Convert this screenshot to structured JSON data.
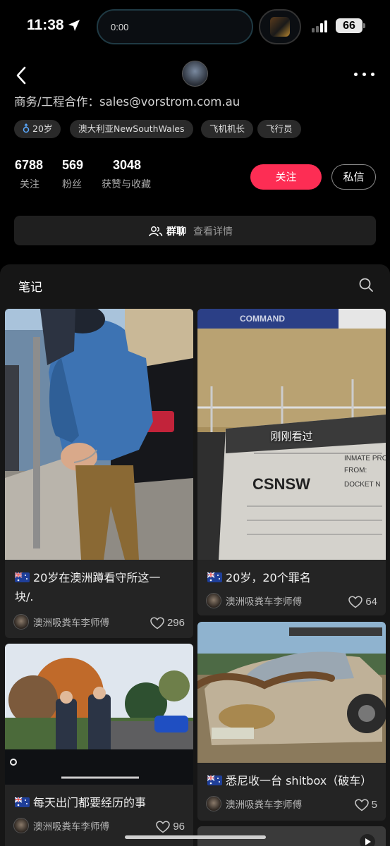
{
  "status_bar": {
    "time": "11:38",
    "island_text": "0:00",
    "battery": "66"
  },
  "profile": {
    "bio": "商务/工程合作：sales@vorstrom.com.au",
    "tags": [
      "20岁",
      "澳大利亚NewSouthWales",
      "飞机机长",
      "飞行员"
    ],
    "stats": [
      {
        "value": "6788",
        "label": "关注"
      },
      {
        "value": "569",
        "label": "粉丝"
      },
      {
        "value": "3048",
        "label": "获赞与收藏"
      }
    ],
    "follow_label": "关注",
    "message_label": "私信",
    "group_label": "群聊",
    "group_detail": "查看详情"
  },
  "notes": {
    "title": "笔记",
    "seen_label": "刚刚看过",
    "cards": [
      {
        "title_line1": "20岁在澳洲蹲看守所这一",
        "title_line2": "块/.",
        "author": "澳洲吸粪车李师傅",
        "likes": "296"
      },
      {
        "title": "20岁，20个罪名",
        "author": "澳洲吸粪车李师傅",
        "likes": "64"
      },
      {
        "title": "每天出门都要经历的事",
        "author": "澳洲吸粪车李师傅",
        "likes": "96"
      },
      {
        "title": "悉尼收一台 shitbox（破车）",
        "author": "澳洲吸粪车李师傅",
        "likes": "5"
      }
    ]
  },
  "photo_text": {
    "csnsw": "CSNSW",
    "inmate": "INMATE PRO",
    "from": "FROM:",
    "docket": "DOCKET N",
    "command": "COMMAND"
  },
  "colors": {
    "accent": "#fd2d54",
    "background": "#000000",
    "panel": "#161616",
    "card": "#242424"
  }
}
